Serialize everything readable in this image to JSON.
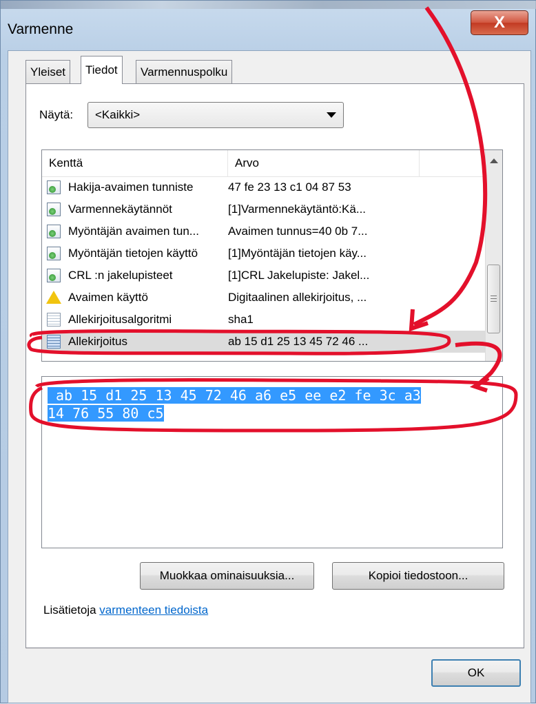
{
  "window": {
    "title": "Varmenne",
    "close_label": "X"
  },
  "tabs": [
    {
      "label": "Yleiset"
    },
    {
      "label": "Tiedot"
    },
    {
      "label": "Varmennuspolku"
    }
  ],
  "show": {
    "label": "Näytä:",
    "selected": "<Kaikki>"
  },
  "list": {
    "columns": {
      "field": "Kenttä",
      "value": "Arvo"
    },
    "rows": [
      {
        "field": "Hakija-avaimen tunniste",
        "value": "47 fe 23 13 c1 04 87 53",
        "icon": "certificate-extension-icon"
      },
      {
        "field": "Varmennekäytännöt",
        "value": "[1]Varmennekäytäntö:Kä...",
        "icon": "certificate-extension-icon"
      },
      {
        "field": "Myöntäjän avaimen tun...",
        "value": "Avaimen tunnus=40 0b 7...",
        "icon": "certificate-extension-icon"
      },
      {
        "field": "Myöntäjän tietojen käyttö",
        "value": "[1]Myöntäjän tietojen käy...",
        "icon": "certificate-extension-icon"
      },
      {
        "field": "CRL :n jakelupisteet",
        "value": "[1]CRL Jakelupiste: Jakel...",
        "icon": "certificate-extension-icon"
      },
      {
        "field": "Avaimen käyttö",
        "value": "Digitaalinen allekirjoitus, ...",
        "icon": "warning-icon"
      },
      {
        "field": "Allekirjoitusalgoritmi",
        "value": "sha1",
        "icon": "document-icon"
      },
      {
        "field": "Allekirjoitus",
        "value": "ab 15 d1 25 13 45 72 46 ...",
        "icon": "document-icon",
        "selected": true
      }
    ]
  },
  "detail": {
    "line1": "ab 15 d1 25 13 45 72 46 a6 e5 ee e2 fe 3c a3",
    "line2": "14 76 55 80 c5"
  },
  "buttons": {
    "edit_properties": "Muokkaa ominaisuuksia...",
    "copy_to_file": "Kopioi tiedostoon...",
    "ok": "OK"
  },
  "more_info": {
    "prefix": "Lisätietoja",
    "link": "varmenteen tiedoista"
  },
  "colors": {
    "annotation": "#e3102b",
    "selection": "#3399ff",
    "link": "#0066cc"
  }
}
